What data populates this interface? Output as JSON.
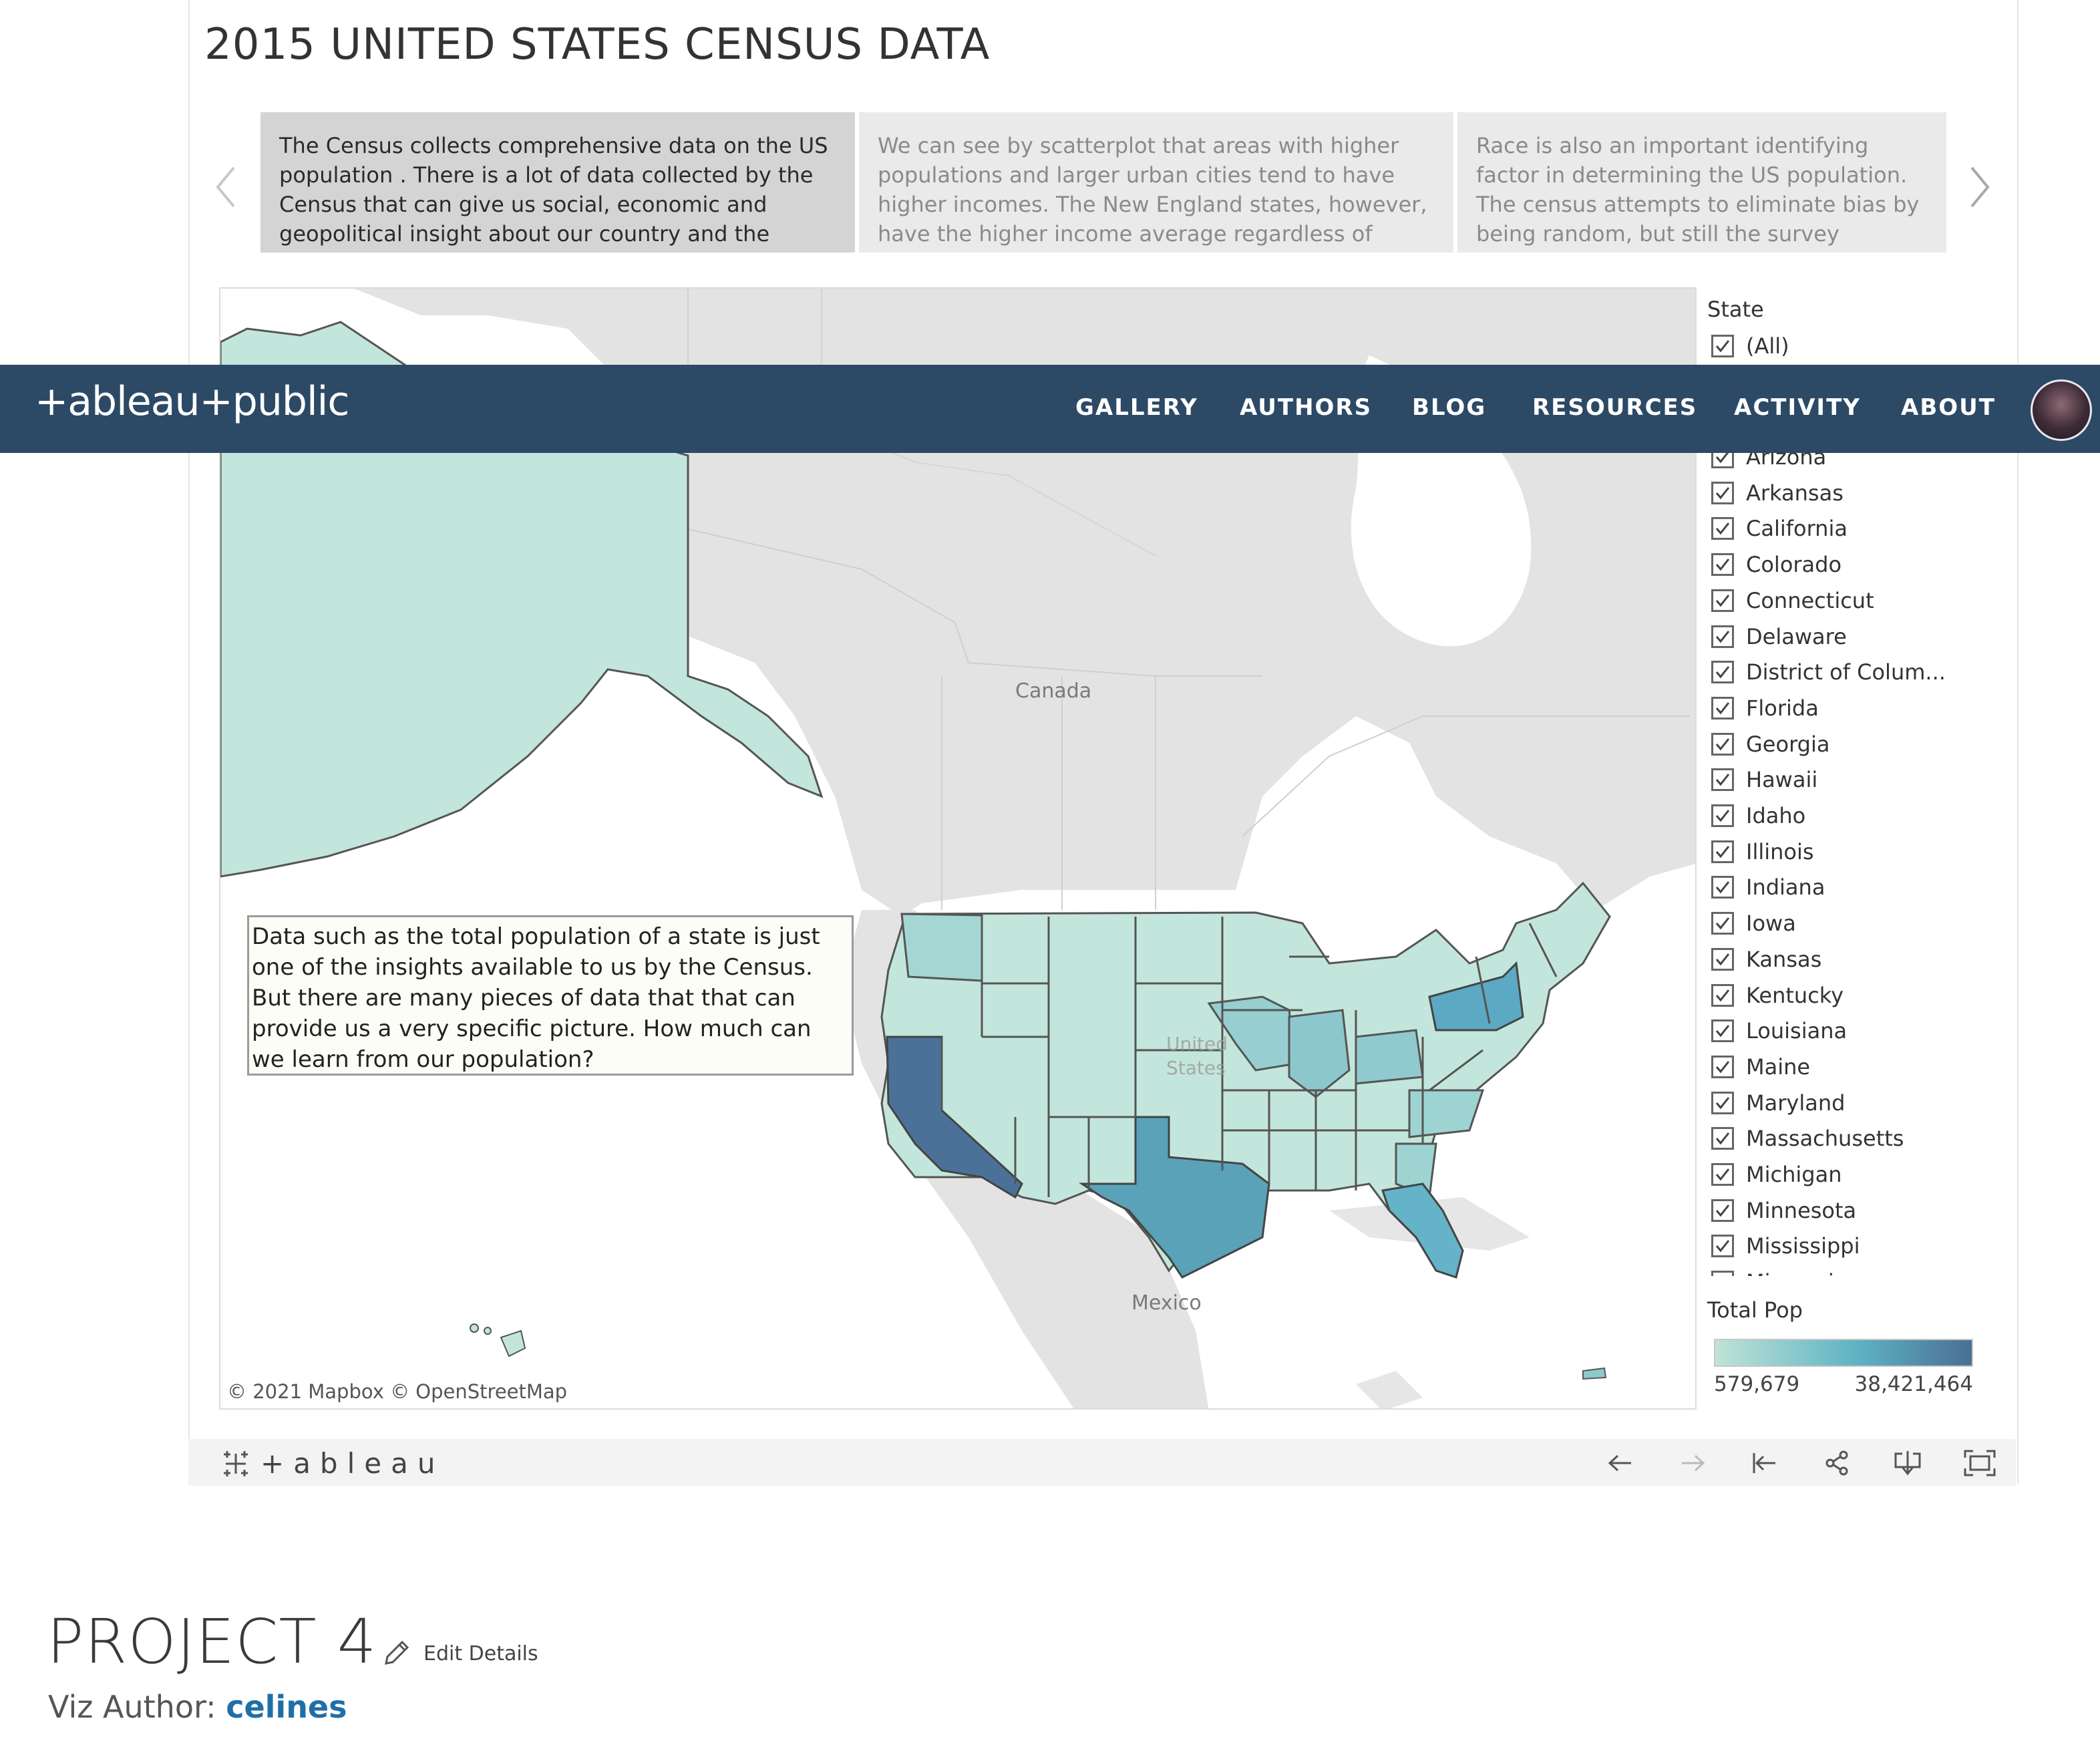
{
  "story": {
    "title": "2015 UNITED STATES CENSUS DATA",
    "points": [
      "The Census collects comprehensive data on the US population . There is a lot of data collected by the Census that can give us social, economic and geopolitical insight about our country and the public.",
      "We can see by scatterplot that areas with higher populations and larger urban cities tend to have higher incomes. The New England states, however, have the higher income average regardless of poulation along",
      "Race is also an important identifying factor in determining the US population. The census attempts to eliminate bias by being random, but still the survey language itself is b"
    ]
  },
  "map": {
    "labels": {
      "canada": "Canada",
      "us_line1": "United",
      "us_line2": "States",
      "mexico": "Mexico"
    },
    "annotation": "Data such as the total population of a state is just one of the insights available to us by the Census. But there are many pieces of data that that can provide us a very specific picture. How much can we learn from our population?",
    "attribution": "© 2021 Mapbox  © OpenStreetMap",
    "colors": {
      "low": "#bfe3d7",
      "mid": "#5fb3c4",
      "high": "#4a6f93"
    }
  },
  "filter": {
    "title": "State",
    "all_label": "(All)",
    "states": [
      "Arizona",
      "Arkansas",
      "California",
      "Colorado",
      "Connecticut",
      "Delaware",
      "District of Colum...",
      "Florida",
      "Georgia",
      "Hawaii",
      "Idaho",
      "Illinois",
      "Indiana",
      "Iowa",
      "Kansas",
      "Kentucky",
      "Louisiana",
      "Maine",
      "Maryland",
      "Massachusetts",
      "Michigan",
      "Minnesota",
      "Mississippi",
      "Missouri"
    ]
  },
  "legend": {
    "title": "Total Pop",
    "min": "579,679",
    "max": "38,421,464"
  },
  "toolbar": {
    "logo": "+ableau"
  },
  "header": {
    "brand": "+ableau+public",
    "nav": [
      "GALLERY",
      "AUTHORS",
      "BLOG",
      "RESOURCES",
      "ACTIVITY",
      "ABOUT"
    ]
  },
  "project": {
    "title": "PROJECT 4",
    "edit_label": "Edit Details",
    "author_prefix": "Viz Author:",
    "author_name": "celines"
  }
}
